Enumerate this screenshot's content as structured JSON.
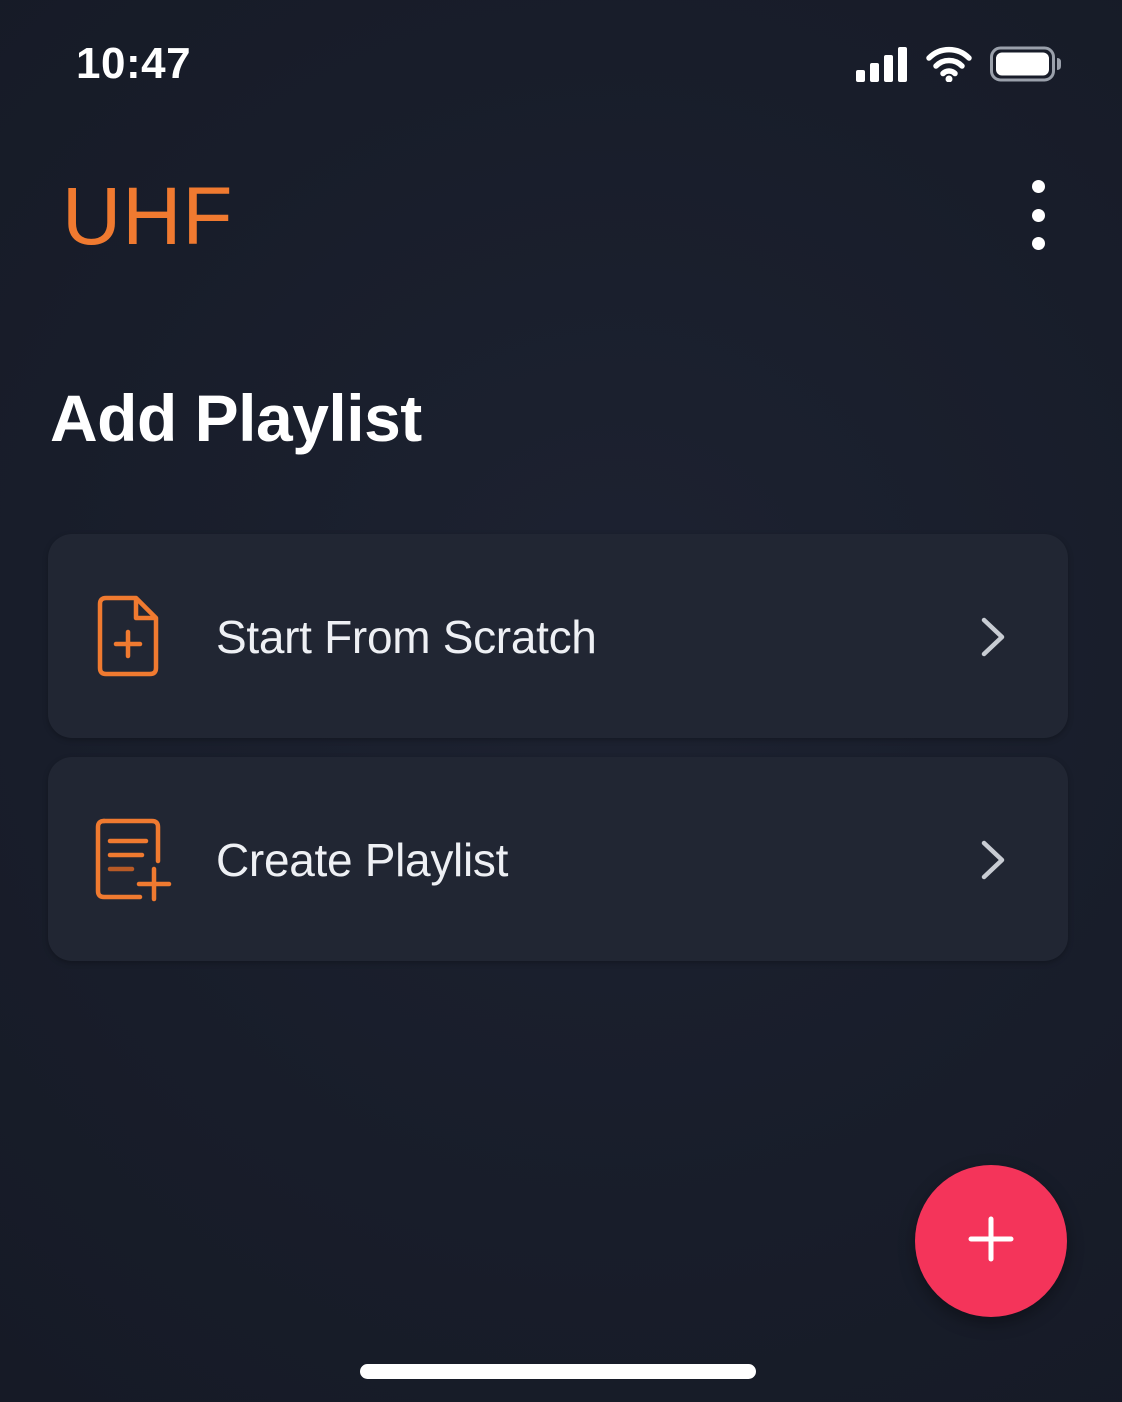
{
  "status_bar": {
    "time": "10:47",
    "icons": [
      "cellular-signal-icon",
      "wifi-icon",
      "battery-icon"
    ]
  },
  "app_bar": {
    "title": "UHF",
    "menu_icon": "more-vertical-icon"
  },
  "page": {
    "heading": "Add Playlist"
  },
  "options": [
    {
      "label": "Start From Scratch",
      "icon": "file-plus-icon",
      "trailing_icon": "chevron-right-icon"
    },
    {
      "label": "Create Playlist",
      "icon": "playlist-add-icon",
      "trailing_icon": "chevron-right-icon"
    }
  ],
  "fab": {
    "icon": "plus-icon"
  },
  "colors": {
    "background": "#181d2a",
    "card": "#212633",
    "accent_orange": "#f07a30",
    "fab_pink": "#f4345a",
    "text": "#ffffff"
  }
}
